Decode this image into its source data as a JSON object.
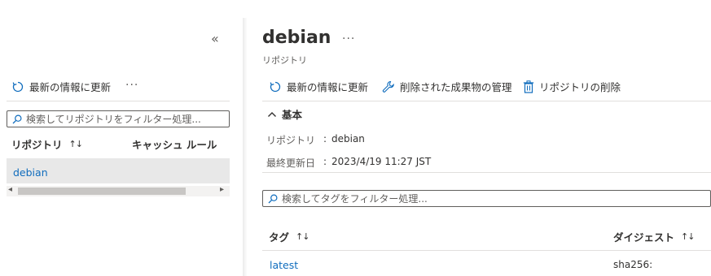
{
  "left": {
    "collapse_glyph": "«",
    "refresh_label": "最新の情報に更新",
    "more_glyph": "···",
    "search_placeholder": "検索してリポジトリをフィルター処理...",
    "columns": {
      "repository": "リポジトリ",
      "cache_rule": "キャッシュ ルール",
      "sort_glyph": "↑↓"
    },
    "rows": [
      {
        "name": "debian"
      }
    ],
    "scroll_left": "◂",
    "scroll_right": "▸"
  },
  "detail": {
    "title": "debian",
    "more_glyph": "···",
    "subtitle": "リポジトリ",
    "toolbar": {
      "refresh": "最新の情報に更新",
      "manage_deleted": "削除された成果物の管理",
      "delete_repo": "リポジトリの削除"
    },
    "essentials": {
      "toggle_glyph": "∧",
      "header": "基本",
      "repo_label": "リポジトリ",
      "repo_value": "debian",
      "updated_label": "最終更新日",
      "updated_value": "2023/4/19 11:27 JST",
      "separator": ":"
    },
    "tag_search_placeholder": "検索してタグをフィルター処理...",
    "table": {
      "col_tag": "タグ",
      "col_digest": "ダイジェスト",
      "sort_glyph": "↑↓",
      "rows": [
        {
          "tag": "latest",
          "digest": "sha256:"
        }
      ]
    }
  },
  "colors": {
    "link": "#0f6cbd",
    "text": "#323130",
    "muted": "#605e5c",
    "selected_row": "#e8e8e8"
  },
  "icons": [
    "refresh-icon",
    "search-icon",
    "wrench-icon",
    "trash-icon",
    "chevron-up-icon",
    "collapse-icon",
    "more-icon"
  ]
}
